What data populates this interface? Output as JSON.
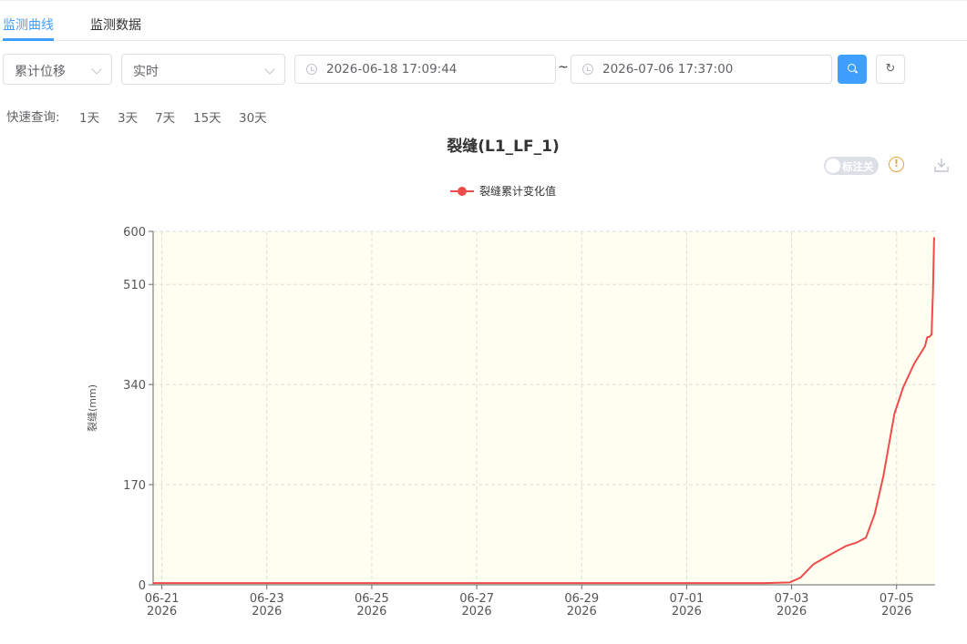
{
  "tabs": [
    {
      "label": "监测曲线",
      "active": true
    },
    {
      "label": "监测数据",
      "active": false
    }
  ],
  "filters": {
    "type_select": "累计位移",
    "mode_select": "实时",
    "start_time": "2026-06-18 17:09:44",
    "range_sep": "~",
    "end_time": "2026-07-06 17:37:00"
  },
  "quick": {
    "label": "快速查询:",
    "options": [
      "1天",
      "3天",
      "7天",
      "15天",
      "30天"
    ]
  },
  "toolbar": {
    "annotate_toggle_label": "标注关",
    "warn_glyph": "!"
  },
  "colors": {
    "accent": "#409eff",
    "series": "#ee4c4c",
    "plot_bg": "#fefff0",
    "warn": "#e6a23c"
  },
  "chart_data": {
    "type": "line",
    "title": "裂缝(L1_LF_1)",
    "ylabel": "裂缝(mm)",
    "xlabel": "",
    "ylim": [
      0,
      600
    ],
    "y_ticks": [
      0,
      170,
      340,
      510,
      600
    ],
    "x_ticks": [
      {
        "x": "2026-06-21",
        "label": "06-21",
        "sub": "2026"
      },
      {
        "x": "2026-06-23",
        "label": "06-23",
        "sub": "2026"
      },
      {
        "x": "2026-06-25",
        "label": "06-25",
        "sub": "2026"
      },
      {
        "x": "2026-06-27",
        "label": "06-27",
        "sub": "2026"
      },
      {
        "x": "2026-06-29",
        "label": "06-29",
        "sub": "2026"
      },
      {
        "x": "2026-07-01",
        "label": "07-01",
        "sub": "2026"
      },
      {
        "x": "2026-07-03",
        "label": "07-03",
        "sub": "2026"
      },
      {
        "x": "2026-07-05",
        "label": "07-05",
        "sub": "2026"
      }
    ],
    "xlim": [
      "2026-06-20 20:00",
      "2026-07-05 17:37"
    ],
    "legend": "top-center",
    "grid": true,
    "series": [
      {
        "name": "裂缝累计变化值",
        "points": [
          [
            "2026-06-20 20:00",
            3
          ],
          [
            "2026-06-21 12:00",
            3
          ],
          [
            "2026-06-22 12:00",
            3
          ],
          [
            "2026-06-23 12:00",
            3
          ],
          [
            "2026-06-24 12:00",
            3
          ],
          [
            "2026-06-25 12:00",
            3
          ],
          [
            "2026-06-26 12:00",
            3
          ],
          [
            "2026-06-27 12:00",
            3
          ],
          [
            "2026-06-28 12:00",
            3
          ],
          [
            "2026-06-29 12:00",
            3
          ],
          [
            "2026-06-30 12:00",
            3
          ],
          [
            "2026-07-01 12:00",
            3
          ],
          [
            "2026-07-02 12:00",
            3
          ],
          [
            "2026-07-02 23:00",
            4
          ],
          [
            "2026-07-03 04:00",
            12
          ],
          [
            "2026-07-03 10:00",
            35
          ],
          [
            "2026-07-03 18:00",
            52
          ],
          [
            "2026-07-04 01:00",
            66
          ],
          [
            "2026-07-04 06:00",
            72
          ],
          [
            "2026-07-04 10:00",
            80
          ],
          [
            "2026-07-04 14:00",
            120
          ],
          [
            "2026-07-04 18:00",
            185
          ],
          [
            "2026-07-04 23:00",
            290
          ],
          [
            "2026-07-05 03:00",
            335
          ],
          [
            "2026-07-05 08:00",
            375
          ],
          [
            "2026-07-05 13:00",
            405
          ],
          [
            "2026-07-05 14:00",
            420
          ],
          [
            "2026-07-05 15:00",
            421
          ],
          [
            "2026-07-05 16:00",
            425
          ],
          [
            "2026-07-05 16:40",
            500
          ],
          [
            "2026-07-05 17:10",
            590
          ]
        ]
      }
    ]
  }
}
